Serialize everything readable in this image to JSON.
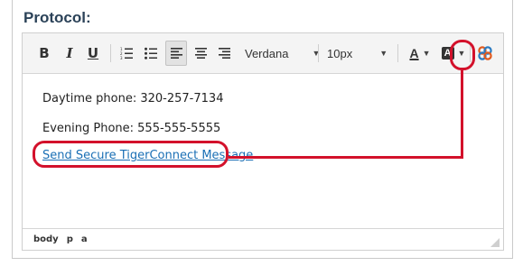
{
  "section_label": "Protocol:",
  "toolbar": {
    "bold": "B",
    "italic": "I",
    "underline": "U",
    "font_family": "Verdana",
    "font_size": "10px",
    "font_color_letter": "A",
    "bg_color_letter": "A",
    "tigerconnect_icon": "tigerconnect-icon"
  },
  "content": {
    "daytime_phone": "Daytime phone: 320-257-7134",
    "evening_phone": "Evening Phone: 555-555-5555",
    "link_text": "Send Secure TigerConnect Message"
  },
  "statusbar": {
    "path": [
      "body",
      "p",
      "a"
    ]
  },
  "colors": {
    "highlight": "#d3112b",
    "link": "#1a6fb5",
    "label": "#2b4258"
  }
}
